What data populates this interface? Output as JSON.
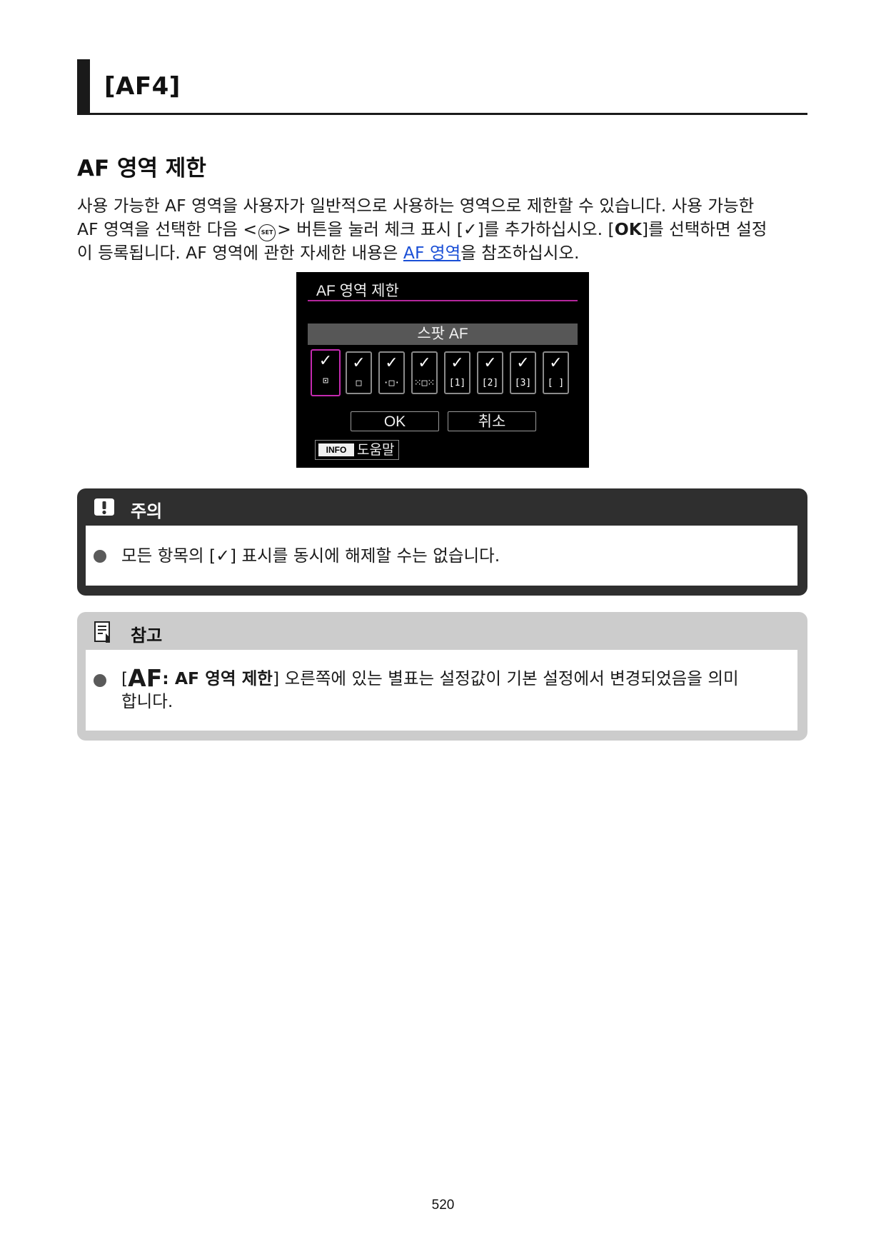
{
  "header": {
    "title": "[AF4]"
  },
  "section": {
    "title": "AF 영역 제한"
  },
  "intro": {
    "line1": "사용 가능한 AF 영역을 사용자가 일반적으로 사용하는 영역으로 제한할 수 있습니다. 사용 가능한",
    "line2_a": "AF 영역을 선택한 다음 <",
    "set_glyph": "SET",
    "line2_b": "> 버튼을 눌러 체크 표시 [",
    "check": "✓",
    "line2_c": "]를 추가하십시오. [",
    "ok": "OK",
    "line2_d": "]를 선택하면 설정",
    "line3_a": "이 등록됩니다. AF 영역에 관한 자세한 내용은 ",
    "link": "AF 영역",
    "line3_b": "을 참조하십시오."
  },
  "camera_screen": {
    "title": "AF 영역 제한",
    "mode": "스팟 AF",
    "cells": [
      {
        "check": "✓",
        "icon": "⊡",
        "icon_name": "spot-af-icon",
        "selected": true
      },
      {
        "check": "✓",
        "icon": "□",
        "icon_name": "one-point-af-icon",
        "selected": false
      },
      {
        "check": "✓",
        "icon": "·□·",
        "icon_name": "expand-af-cross-icon",
        "selected": false
      },
      {
        "check": "✓",
        "icon": "⁙□⁙",
        "icon_name": "expand-af-surround-icon",
        "selected": false
      },
      {
        "check": "✓",
        "icon": "[1]",
        "icon_name": "flexible-zone-1-icon",
        "selected": false
      },
      {
        "check": "✓",
        "icon": "[2]",
        "icon_name": "flexible-zone-2-icon",
        "selected": false
      },
      {
        "check": "✓",
        "icon": "[3]",
        "icon_name": "flexible-zone-3-icon",
        "selected": false
      },
      {
        "check": "✓",
        "icon": "[ ]",
        "icon_name": "whole-area-af-icon",
        "selected": false
      }
    ],
    "ok_label": "OK",
    "cancel_label": "취소",
    "info_badge": "INFO",
    "help_label": "도움말"
  },
  "caution": {
    "label": "주의",
    "item_a": "모든 항목의 [",
    "item_check": "✓",
    "item_b": "] 표시를 동시에 해제할 수는 없습니다."
  },
  "note": {
    "label": "참고",
    "item_bracket_open": "[",
    "item_af_symbol": "AF",
    "item_bold": ": AF 영역 제한",
    "item_rest_line1": "] 오른쪽에 있는 별표는 설정값이 기본 설정에서 변경되었음을 의미",
    "item_rest_line2": "합니다."
  },
  "page_number": "520",
  "colors": {
    "accent_magenta": "#c42ab0",
    "link": "#1a4fd6",
    "caution_bg": "#2f2f2f",
    "note_bg": "#cccccc"
  }
}
